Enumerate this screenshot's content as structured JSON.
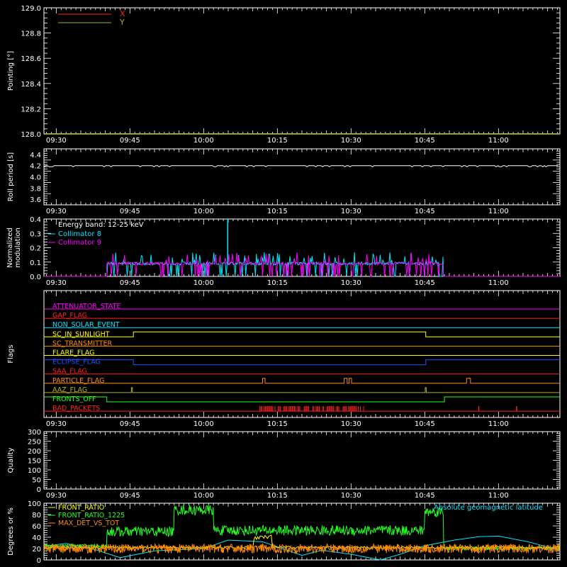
{
  "figure": {
    "background": "#000000",
    "foreground": "#ffffff"
  },
  "time_ticks": [
    "09:30",
    "09:45",
    "10:00",
    "10:15",
    "10:30",
    "10:45",
    "11:00"
  ],
  "time_tick_values": [
    570,
    585,
    600,
    615,
    630,
    645,
    660
  ],
  "time_range": [
    567.5,
    672.5
  ],
  "chart_data": [
    {
      "id": "pointing",
      "type": "line",
      "ylabel": "Pointing [°]",
      "ylim": [
        128.0,
        129.0
      ],
      "yticks": [
        "128.0",
        "128.2",
        "128.4",
        "128.6",
        "128.8",
        "129.0"
      ],
      "ytick_values": [
        128.0,
        128.2,
        128.4,
        128.6,
        128.8,
        129.0
      ],
      "legend": [
        {
          "name": "X",
          "color": "#ff2020"
        },
        {
          "name": "Y",
          "color": "#b0b020"
        }
      ],
      "series": [
        {
          "name": "X",
          "color": "#ff2020",
          "x": [
            567.5,
            672.5
          ],
          "y": [
            128.0,
            128.0
          ]
        },
        {
          "name": "Y",
          "color": "#b0b020",
          "x": [
            567.5,
            672.5
          ],
          "y": [
            128.0,
            128.0
          ]
        }
      ]
    },
    {
      "id": "roll",
      "type": "line",
      "ylabel": "Roll period [s]",
      "ylim": [
        3.5,
        4.5
      ],
      "yticks": [
        "3.6",
        "3.8",
        "4.0",
        "4.2",
        "4.4"
      ],
      "ytick_values": [
        3.6,
        3.8,
        4.0,
        4.2,
        4.4
      ],
      "series": [
        {
          "name": "",
          "color": "#ffffff",
          "x": [
            567.5,
            672.5
          ],
          "y": [
            4.2,
            4.2
          ]
        }
      ]
    },
    {
      "id": "modulation",
      "type": "line",
      "ylabel": "Normalized\nmodulation",
      "ylim": [
        0.0,
        0.4
      ],
      "yticks": [
        "0.0",
        "0.1",
        "0.2",
        "0.3",
        "0.4"
      ],
      "ytick_values": [
        0.0,
        0.1,
        0.2,
        0.3,
        0.4
      ],
      "annotation": "Energy band: 12-25 keV",
      "legend": [
        {
          "name": "Collimator 8",
          "color": "#00e5ff"
        },
        {
          "name": "Collimator 9",
          "color": "#ff00ff"
        }
      ],
      "active_range": [
        580.3,
        648.8
      ],
      "baseline": 0.09,
      "series": [
        {
          "name": "Collimator 8",
          "color": "#00e5ff"
        },
        {
          "name": "Collimator 9",
          "color": "#ff00ff"
        }
      ],
      "spike": {
        "x": 604.9,
        "y": 0.4
      }
    },
    {
      "id": "flags",
      "type": "line",
      "ylabel": "Flags",
      "flags": [
        {
          "name": "ATTENUATOR_STATE",
          "color": "#ff00ff",
          "steps": []
        },
        {
          "name": "GAP_FLAG",
          "color": "#ff2020",
          "steps": []
        },
        {
          "name": "NON_SOLAR_EVENT",
          "color": "#00e5ff",
          "steps": []
        },
        {
          "name": "SC_IN_SUNLIGHT",
          "color": "#ffff00",
          "steps": [
            [
              567.5,
              0
            ],
            [
              585.7,
              1
            ],
            [
              645.2,
              0
            ]
          ]
        },
        {
          "name": "SC_TRANSMITTER",
          "color": "#ff8c00",
          "steps": []
        },
        {
          "name": "FLARE_FLAG",
          "color": "#ffff00",
          "steps": []
        },
        {
          "name": "ECLIPSE_FLAG",
          "color": "#2050ff",
          "steps": [
            [
              567.5,
              1
            ],
            [
              585.7,
              0
            ],
            [
              645.2,
              1
            ]
          ]
        },
        {
          "name": "SAA_FLAG",
          "color": "#ff2020",
          "steps": []
        },
        {
          "name": "PARTICLE_FLAG",
          "color": "#ff8c00",
          "steps": [
            [
              567.5,
              0
            ],
            [
              612.0,
              1
            ],
            [
              612.5,
              0
            ],
            [
              628.6,
              1
            ],
            [
              629.2,
              0
            ],
            [
              629.6,
              1
            ],
            [
              630.1,
              0
            ],
            [
              653.5,
              1
            ],
            [
              654.3,
              0
            ]
          ]
        },
        {
          "name": "AAZ_FLAG",
          "color": "#b0b020",
          "steps": [
            [
              567.5,
              0
            ],
            [
              585.3,
              1
            ],
            [
              585.5,
              0
            ],
            [
              645.1,
              1
            ],
            [
              645.3,
              0
            ]
          ]
        },
        {
          "name": "FRONTS_OFF",
          "color": "#20ff20",
          "steps": [
            [
              567.5,
              1
            ],
            [
              580.3,
              0
            ],
            [
              649.0,
              1
            ]
          ]
        },
        {
          "name": "BAD_PACKETS",
          "color": "#ff2020",
          "steps": []
        }
      ],
      "bad_packet_range": [
        611.0,
        632.7
      ],
      "bad_packet_isolated": [
        656.0,
        663.7
      ]
    },
    {
      "id": "quality",
      "type": "line",
      "ylabel": "Quality",
      "ylim": [
        0,
        300
      ],
      "yticks": [
        "0",
        "50",
        "100",
        "150",
        "200",
        "250",
        "300"
      ],
      "ytick_values": [
        0,
        50,
        100,
        150,
        200,
        250,
        300
      ],
      "series": []
    },
    {
      "id": "ratios",
      "type": "line",
      "ylabel": "Degrees or %",
      "ylim": [
        0,
        100
      ],
      "yticks": [
        "0",
        "20",
        "40",
        "60",
        "80",
        "100"
      ],
      "ytick_values": [
        0,
        20,
        40,
        60,
        80,
        100
      ],
      "legend": [
        {
          "name": "FRONT_RATIO",
          "color": "#ffff00"
        },
        {
          "name": "FRONT_RATIO_1225",
          "color": "#20ff20"
        },
        {
          "name": "MAX_DET_VS_TOT",
          "color": "#ff8c00"
        }
      ],
      "annotation": "Absolute geomagnetic latitude",
      "annotation_color": "#00e5ff",
      "series": [
        {
          "name": "FRONT_RATIO",
          "color": "#ffff00"
        },
        {
          "name": "FRONT_RATIO_1225",
          "color": "#20ff20"
        },
        {
          "name": "MAX_DET_VS_TOT",
          "color": "#ff8c00"
        },
        {
          "name": "Absolute geomagnetic latitude",
          "color": "#00e5ff",
          "x": [
            567.5,
            572,
            578,
            583,
            590,
            600,
            605,
            612,
            616,
            620,
            624,
            630,
            636,
            640,
            645,
            651,
            656,
            660,
            666,
            672.5
          ],
          "y": [
            24,
            29,
            18,
            4,
            16,
            20,
            35,
            32,
            20,
            8,
            17,
            10,
            0,
            10,
            25,
            35,
            41,
            42,
            32,
            17
          ]
        }
      ]
    }
  ]
}
